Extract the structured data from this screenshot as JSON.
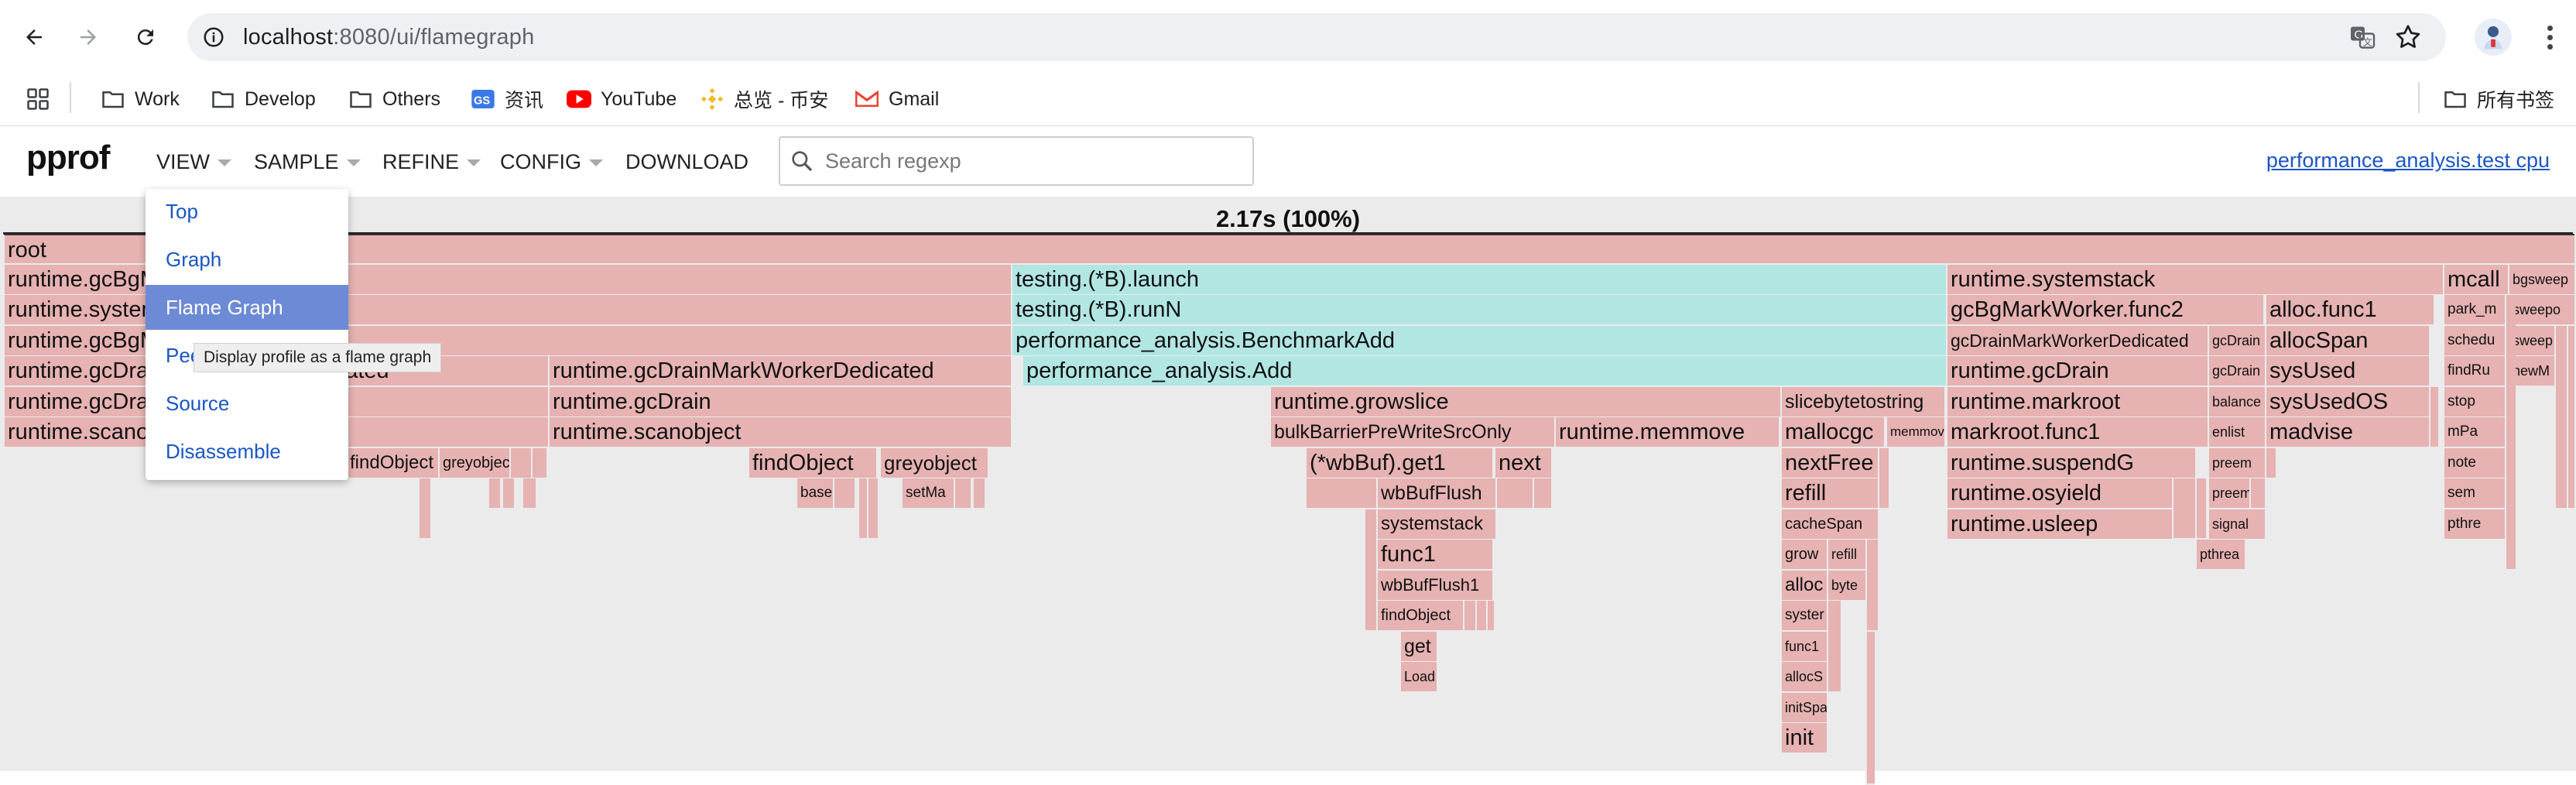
{
  "browser": {
    "url_host": "localhost",
    "url_rest": ":8080/ui/flamegraph",
    "icons": [
      "back-arrow-icon",
      "forward-arrow-icon",
      "reload-icon",
      "site-info-icon",
      "translate-icon",
      "star-icon",
      "apps-grid-icon"
    ],
    "bookmarks": [
      {
        "label": "Work",
        "icon": "folder-icon"
      },
      {
        "label": "Develop",
        "icon": "folder-icon"
      },
      {
        "label": "Others",
        "icon": "folder-icon"
      },
      {
        "label": "资讯",
        "icon": "news-icon"
      },
      {
        "label": "YouTube",
        "icon": "youtube-icon"
      },
      {
        "label": "总览 - 币安",
        "icon": "binance-icon"
      },
      {
        "label": "Gmail",
        "icon": "gmail-icon"
      }
    ],
    "all_bookmarks": "所有书签"
  },
  "header": {
    "logo": "pprof",
    "menus": [
      "VIEW",
      "SAMPLE",
      "REFINE",
      "CONFIG",
      "DOWNLOAD"
    ],
    "search_placeholder": "Search regexp",
    "profile_link": "performance_analysis.test cpu"
  },
  "view_menu": {
    "items": [
      "Top",
      "Graph",
      "Flame Graph",
      "Peek",
      "Source",
      "Disassemble"
    ],
    "active": "Flame Graph",
    "tooltip": "Display profile as a flame graph"
  },
  "flame": {
    "total": "2.17s (100%)",
    "colors": {
      "pink": "#e6b2b2",
      "teal": "#b1e6e3",
      "background": "#ebebeb"
    },
    "frames": [
      {
        "label": "root"
      },
      {
        "label": "runtime.gcBgMarkWorker"
      },
      {
        "label": "runtime.systemstack"
      },
      {
        "label": "runtime.gcBgMarkWorker.func2"
      },
      {
        "label": "runtime.gcDrainMarkWorkerDedicated"
      },
      {
        "label": "runtime.gcDrain"
      },
      {
        "label": "runtime.scanobject"
      },
      {
        "label": "runtime.gcDrainMarkWorkerDedicated"
      },
      {
        "label": "runtime.gcDrain"
      },
      {
        "label": "runtime.scanobject"
      },
      {
        "label": "findObject"
      },
      {
        "label": "greyobject"
      },
      {
        "label": "findObject"
      },
      {
        "label": "greyobject"
      },
      {
        "label": "base"
      },
      {
        "label": "setMa"
      },
      {
        "label": "testing.(*B).launch"
      },
      {
        "label": "testing.(*B).runN"
      },
      {
        "label": "performance_analysis.BenchmarkAdd"
      },
      {
        "label": "performance_analysis.Add"
      },
      {
        "label": "runtime.growslice"
      },
      {
        "label": "slicebytetostring"
      },
      {
        "label": "bulkBarrierPreWriteSrcOnly"
      },
      {
        "label": "runtime.memmove"
      },
      {
        "label": "mallocgc"
      },
      {
        "label": "memmove"
      },
      {
        "label": "(*wbBuf).get1"
      },
      {
        "label": "next"
      },
      {
        "label": "nextFree"
      },
      {
        "label": "wbBufFlush"
      },
      {
        "label": "refill"
      },
      {
        "label": "systemstack"
      },
      {
        "label": "cacheSpan"
      },
      {
        "label": "func1"
      },
      {
        "label": "grow"
      },
      {
        "label": "refill"
      },
      {
        "label": "wbBufFlush1"
      },
      {
        "label": "alloc"
      },
      {
        "label": "byte"
      },
      {
        "label": "findObject"
      },
      {
        "label": "syster"
      },
      {
        "label": "get"
      },
      {
        "label": "func1"
      },
      {
        "label": "Load"
      },
      {
        "label": "allocS"
      },
      {
        "label": "initSpa"
      },
      {
        "label": "init"
      },
      {
        "label": "runtime.systemstack"
      },
      {
        "label": "gcBgMarkWorker.func2"
      },
      {
        "label": "alloc.func1"
      },
      {
        "label": "gcDrainMarkWorkerDedicated"
      },
      {
        "label": "gcDrain"
      },
      {
        "label": "allocSpan"
      },
      {
        "label": "runtime.gcDrain"
      },
      {
        "label": "gcDrain"
      },
      {
        "label": "sysUsed"
      },
      {
        "label": "runtime.markroot"
      },
      {
        "label": "balance"
      },
      {
        "label": "sysUsedOS"
      },
      {
        "label": "markroot.func1"
      },
      {
        "label": "enlist"
      },
      {
        "label": "madvise"
      },
      {
        "label": "runtime.suspendG"
      },
      {
        "label": "preem"
      },
      {
        "label": "runtime.osyield"
      },
      {
        "label": "preem"
      },
      {
        "label": "runtime.usleep"
      },
      {
        "label": "signal"
      },
      {
        "label": "pthrea"
      },
      {
        "label": "mcall"
      },
      {
        "label": "bgsweep"
      },
      {
        "label": "park_m"
      },
      {
        "label": "sweepo"
      },
      {
        "label": "schedu"
      },
      {
        "label": "sweep"
      },
      {
        "label": "findRu"
      },
      {
        "label": "newM"
      },
      {
        "label": "stop"
      },
      {
        "label": "mPa"
      },
      {
        "label": "note"
      },
      {
        "label": "sem"
      },
      {
        "label": "pthre"
      }
    ]
  }
}
